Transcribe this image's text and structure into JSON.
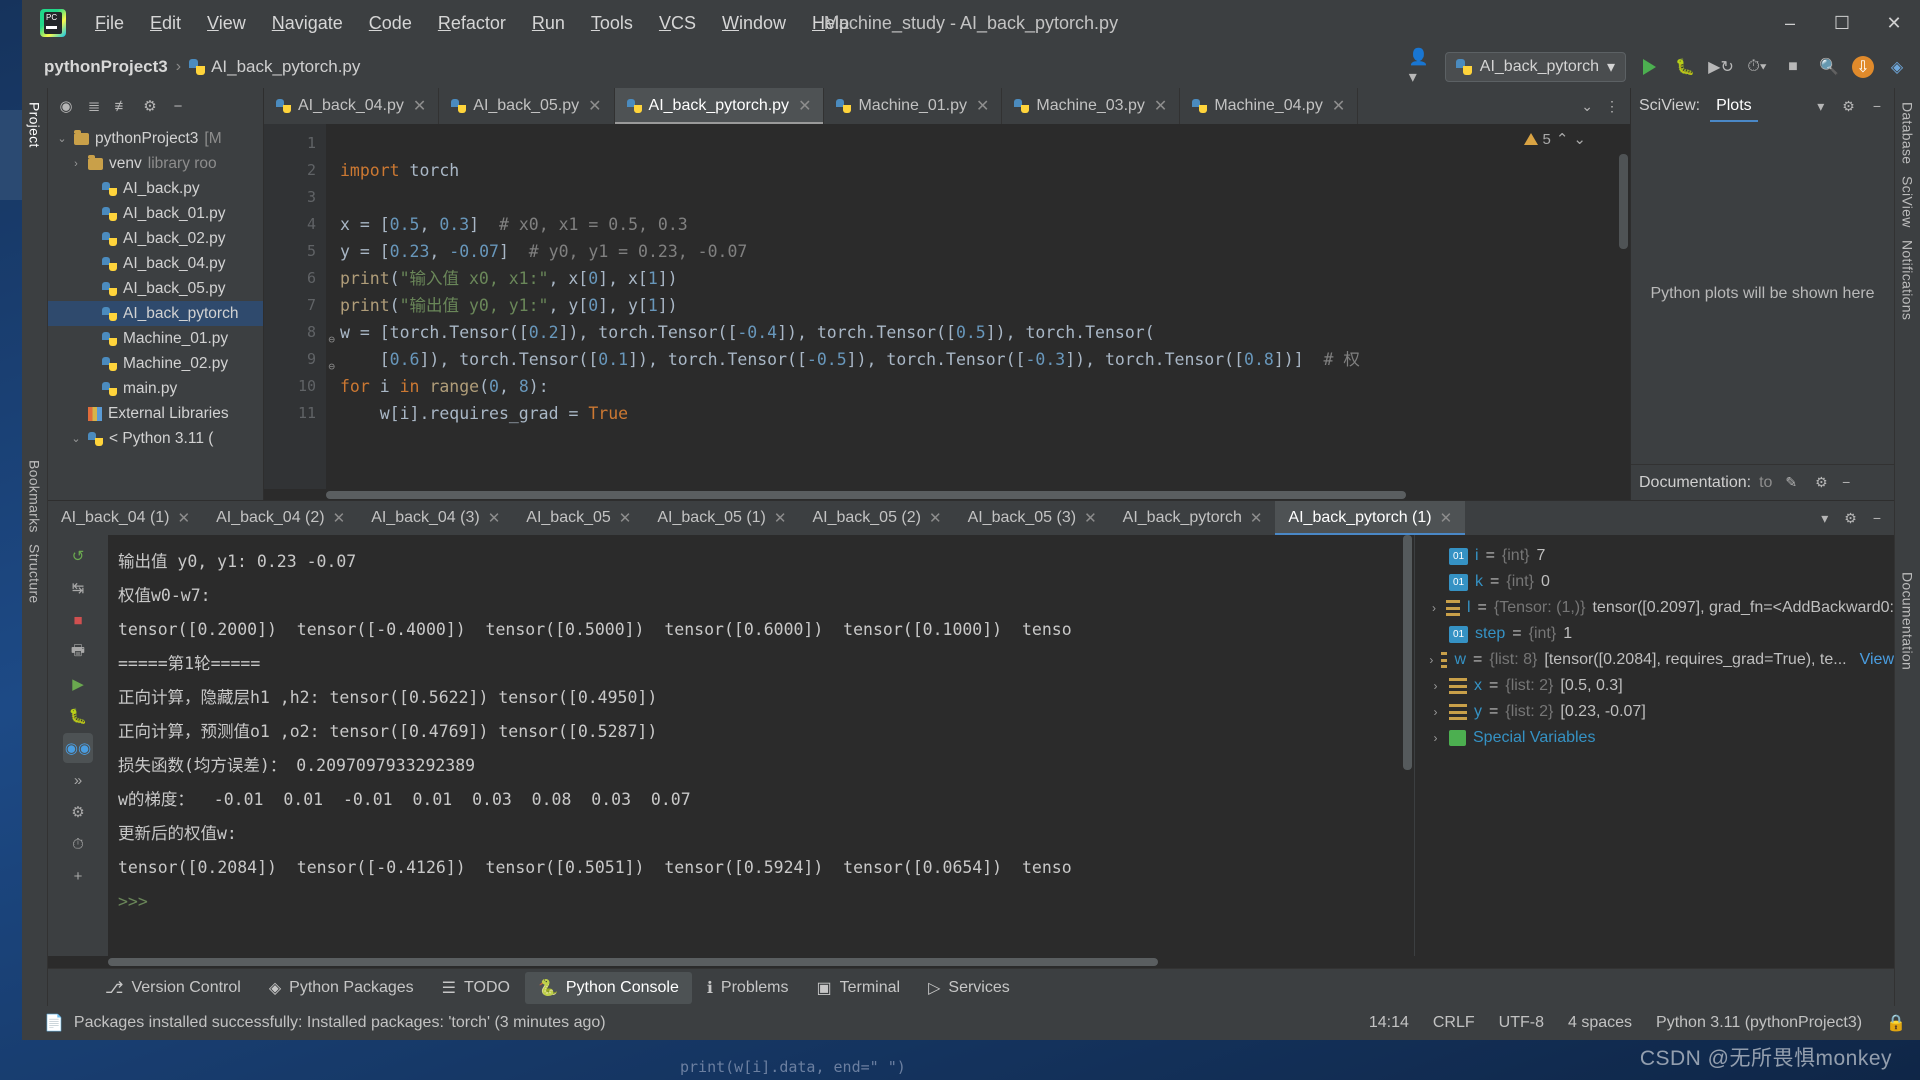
{
  "window": {
    "title": "Machine_study - AI_back_pytorch.py",
    "logo_text": "PC",
    "minimize": "–",
    "maximize": "☐",
    "close": "✕"
  },
  "menu": [
    {
      "label": "File"
    },
    {
      "label": "Edit"
    },
    {
      "label": "View"
    },
    {
      "label": "Navigate"
    },
    {
      "label": "Code"
    },
    {
      "label": "Refactor"
    },
    {
      "label": "Run"
    },
    {
      "label": "Tools"
    },
    {
      "label": "VCS"
    },
    {
      "label": "Window"
    },
    {
      "label": "Help"
    }
  ],
  "toolbar": {
    "breadcrumb_project": "pythonProject3",
    "breadcrumb_sep": "›",
    "breadcrumb_file": "AI_back_pytorch.py",
    "run_config": "AI_back_pytorch",
    "run_config_caret": "▾",
    "icons": {
      "user": "user-icon",
      "run": "run-icon",
      "debug": "debug-icon",
      "run_coverage": "run-coverage-icon",
      "profile": "profile-icon",
      "stop": "stop-icon",
      "search": "search-icon",
      "update": "update-icon",
      "ai": "ai-assistant-icon"
    }
  },
  "left_strip": [
    {
      "label": "Project",
      "selected": true
    },
    {
      "label": "Bookmarks",
      "selected": false
    },
    {
      "label": "Structure",
      "selected": false
    }
  ],
  "right_strip": [
    {
      "label": "Database"
    },
    {
      "label": "SciView"
    },
    {
      "label": "Notifications"
    },
    {
      "label": "Documentation"
    }
  ],
  "project": {
    "header_icons": [
      "project-widget-icon",
      "gear-icon",
      "collapse-icon",
      "expand-icon",
      "hide-icon"
    ],
    "tree": [
      {
        "indent": 0,
        "twisty": "⌄",
        "icon": "folder",
        "label": "pythonProject3",
        "suffix": "[M",
        "selected": false
      },
      {
        "indent": 1,
        "twisty": "›",
        "icon": "folder",
        "label": "venv",
        "suffix": "library roo",
        "selected": false
      },
      {
        "indent": 2,
        "twisty": "",
        "icon": "py",
        "label": "AI_back.py",
        "suffix": "",
        "selected": false
      },
      {
        "indent": 2,
        "twisty": "",
        "icon": "py",
        "label": "AI_back_01.py",
        "suffix": "",
        "selected": false
      },
      {
        "indent": 2,
        "twisty": "",
        "icon": "py",
        "label": "AI_back_02.py",
        "suffix": "",
        "selected": false
      },
      {
        "indent": 2,
        "twisty": "",
        "icon": "py",
        "label": "AI_back_04.py",
        "suffix": "",
        "selected": false
      },
      {
        "indent": 2,
        "twisty": "",
        "icon": "py",
        "label": "AI_back_05.py",
        "suffix": "",
        "selected": false
      },
      {
        "indent": 2,
        "twisty": "",
        "icon": "py",
        "label": "AI_back_pytorch",
        "suffix": "",
        "selected": true
      },
      {
        "indent": 2,
        "twisty": "",
        "icon": "py",
        "label": "Machine_01.py",
        "suffix": "",
        "selected": false
      },
      {
        "indent": 2,
        "twisty": "",
        "icon": "py",
        "label": "Machine_02.py",
        "suffix": "",
        "selected": false
      },
      {
        "indent": 2,
        "twisty": "",
        "icon": "py",
        "label": "main.py",
        "suffix": "",
        "selected": false
      },
      {
        "indent": 1,
        "twisty": "",
        "icon": "lib",
        "label": "External Libraries",
        "suffix": "",
        "selected": false
      },
      {
        "indent": 1,
        "twisty": "⌄",
        "icon": "py",
        "label": "< Python 3.11 (",
        "suffix": "",
        "selected": false
      }
    ]
  },
  "editor": {
    "tabs": [
      {
        "label": "AI_back_04.py",
        "active": false
      },
      {
        "label": "AI_back_05.py",
        "active": false
      },
      {
        "label": "AI_back_pytorch.py",
        "active": true
      },
      {
        "label": "Machine_01.py",
        "active": false
      },
      {
        "label": "Machine_03.py",
        "active": false
      },
      {
        "label": "Machine_04.py",
        "active": false
      }
    ],
    "tab_close_glyph": "✕",
    "tabs_overflow": "⌄",
    "tabs_more": "⋮",
    "warning_count": "5",
    "warn_up": "⌃",
    "warn_down": "⌄",
    "lines": [
      {
        "num": "1",
        "tokens": []
      },
      {
        "num": "2",
        "tokens": [
          {
            "t": "import",
            "c": "k"
          },
          {
            "t": " torch",
            "c": "id"
          }
        ]
      },
      {
        "num": "3",
        "tokens": []
      },
      {
        "num": "4",
        "tokens": [
          {
            "t": "x = [",
            "c": "id"
          },
          {
            "t": "0.5",
            "c": "n"
          },
          {
            "t": ", ",
            "c": "id"
          },
          {
            "t": "0.3",
            "c": "n"
          },
          {
            "t": "]  ",
            "c": "id"
          },
          {
            "t": "# x0, x1 = 0.5, 0.3",
            "c": "c"
          }
        ]
      },
      {
        "num": "5",
        "tokens": [
          {
            "t": "y = [",
            "c": "id"
          },
          {
            "t": "0.23",
            "c": "n"
          },
          {
            "t": ", ",
            "c": "id"
          },
          {
            "t": "-0.07",
            "c": "n"
          },
          {
            "t": "]  ",
            "c": "id"
          },
          {
            "t": "# y0, y1 = 0.23, -0.07",
            "c": "c"
          }
        ]
      },
      {
        "num": "6",
        "tokens": [
          {
            "t": "print",
            "c": "f"
          },
          {
            "t": "(",
            "c": "id"
          },
          {
            "t": "\"输入值 x0, x1:\"",
            "c": "s"
          },
          {
            "t": ", x[",
            "c": "id"
          },
          {
            "t": "0",
            "c": "n"
          },
          {
            "t": "], x[",
            "c": "id"
          },
          {
            "t": "1",
            "c": "n"
          },
          {
            "t": "])",
            "c": "id"
          }
        ]
      },
      {
        "num": "7",
        "tokens": [
          {
            "t": "print",
            "c": "f"
          },
          {
            "t": "(",
            "c": "id"
          },
          {
            "t": "\"输出值 y0, y1:\"",
            "c": "s"
          },
          {
            "t": ", y[",
            "c": "id"
          },
          {
            "t": "0",
            "c": "n"
          },
          {
            "t": "], y[",
            "c": "id"
          },
          {
            "t": "1",
            "c": "n"
          },
          {
            "t": "])",
            "c": "id"
          }
        ]
      },
      {
        "num": "8",
        "tokens": [
          {
            "t": "w = [torch.Tensor([",
            "c": "id"
          },
          {
            "t": "0.2",
            "c": "n"
          },
          {
            "t": "]), torch.Tensor([",
            "c": "id"
          },
          {
            "t": "-0.4",
            "c": "n"
          },
          {
            "t": "]), torch.Tensor([",
            "c": "id"
          },
          {
            "t": "0.5",
            "c": "n"
          },
          {
            "t": "]), torch.Tensor(",
            "c": "id"
          }
        ]
      },
      {
        "num": "9",
        "tokens": [
          {
            "t": "    [",
            "c": "id"
          },
          {
            "t": "0.6",
            "c": "n"
          },
          {
            "t": "]), torch.Tensor([",
            "c": "id"
          },
          {
            "t": "0.1",
            "c": "n"
          },
          {
            "t": "]), torch.Tensor([",
            "c": "id"
          },
          {
            "t": "-0.5",
            "c": "n"
          },
          {
            "t": "]), torch.Tensor([",
            "c": "id"
          },
          {
            "t": "-0.3",
            "c": "n"
          },
          {
            "t": "]), torch.Tensor([",
            "c": "id"
          },
          {
            "t": "0.8",
            "c": "n"
          },
          {
            "t": "])]  ",
            "c": "id"
          },
          {
            "t": "# 权",
            "c": "c"
          }
        ]
      },
      {
        "num": "10",
        "tokens": [
          {
            "t": "for",
            "c": "k"
          },
          {
            "t": " i ",
            "c": "id"
          },
          {
            "t": "in",
            "c": "k"
          },
          {
            "t": " ",
            "c": "id"
          },
          {
            "t": "range",
            "c": "f"
          },
          {
            "t": "(",
            "c": "id"
          },
          {
            "t": "0",
            "c": "n"
          },
          {
            "t": ", ",
            "c": "id"
          },
          {
            "t": "8",
            "c": "n"
          },
          {
            "t": "):",
            "c": "id"
          }
        ]
      },
      {
        "num": "11",
        "tokens": [
          {
            "t": "    w[i].requires_grad = ",
            "c": "id"
          },
          {
            "t": "True",
            "c": "k"
          }
        ]
      }
    ]
  },
  "sciview": {
    "label": "SciView:",
    "tab": "Plots",
    "empty_message": "Python plots will be shown here",
    "doc_label": "Documentation:",
    "doc_value": "to",
    "icons": [
      "chevron-down-icon",
      "gear-icon",
      "hide-icon",
      "edit-icon"
    ]
  },
  "console": {
    "tabs": [
      {
        "label": "AI_back_04 (1)",
        "active": false
      },
      {
        "label": "AI_back_04 (2)",
        "active": false
      },
      {
        "label": "AI_back_04 (3)",
        "active": false
      },
      {
        "label": "AI_back_05",
        "active": false
      },
      {
        "label": "AI_back_05 (1)",
        "active": false
      },
      {
        "label": "AI_back_05 (2)",
        "active": false
      },
      {
        "label": "AI_back_05 (3)",
        "active": false
      },
      {
        "label": "AI_back_pytorch",
        "active": false
      },
      {
        "label": "AI_back_pytorch (1)",
        "active": true
      }
    ],
    "tab_close_glyph": "✕",
    "gutter_icons": [
      "rerun-icon",
      "soft-wrap-icon",
      "stop-icon",
      "print-icon",
      "execute-icon",
      "attach-debugger-icon",
      "show-variables-icon",
      "scroll-to-end-icon",
      "settings-icon",
      "history-icon",
      "add-icon"
    ],
    "output": [
      "输出值 y0, y1: 0.23 -0.07",
      "权值w0-w7:",
      "tensor([0.2000])  tensor([-0.4000])  tensor([0.5000])  tensor([0.6000])  tensor([0.1000])  tenso",
      "=====第1轮=====",
      "正向计算，隐藏层h1 ,h2: tensor([0.5622]) tensor([0.4950])",
      "正向计算，预测值o1 ,o2: tensor([0.4769]) tensor([0.5287])",
      "损失函数(均方误差)： 0.2097097933292389",
      "w的梯度：  -0.01  0.01  -0.01  0.01  0.03  0.08  0.03  0.07",
      "更新后的权值w:",
      "tensor([0.2084])  tensor([-0.4126])  tensor([0.5051])  tensor([0.5924])  tensor([0.0654])  tenso"
    ],
    "prompt": ">>>"
  },
  "variables": [
    {
      "arrow": "",
      "icon": "int",
      "name": "i",
      "type": "{int}",
      "value": "7",
      "link": ""
    },
    {
      "arrow": "",
      "icon": "int",
      "name": "k",
      "type": "{int}",
      "value": "0",
      "link": ""
    },
    {
      "arrow": "›",
      "icon": "list",
      "name": "l",
      "type": "{Tensor: (1,)}",
      "value": "tensor([0.2097], grad_fn=<AddBackward0:",
      "link": ""
    },
    {
      "arrow": "",
      "icon": "int",
      "name": "step",
      "type": "{int}",
      "value": "1",
      "link": ""
    },
    {
      "arrow": "›",
      "icon": "list",
      "name": "w",
      "type": "{list: 8}",
      "value": "[tensor([0.2084], requires_grad=True), te...",
      "link": "View"
    },
    {
      "arrow": "›",
      "icon": "list",
      "name": "x",
      "type": "{list: 2}",
      "value": "[0.5, 0.3]",
      "link": ""
    },
    {
      "arrow": "›",
      "icon": "list",
      "name": "y",
      "type": "{list: 2}",
      "value": "[0.23, -0.07]",
      "link": ""
    },
    {
      "arrow": "›",
      "icon": "star",
      "name": "Special Variables",
      "type": "",
      "value": "",
      "link": ""
    }
  ],
  "bottom_bar": [
    {
      "label": "Version Control",
      "icon": "branch-icon",
      "active": false
    },
    {
      "label": "Python Packages",
      "icon": "packages-icon",
      "active": false
    },
    {
      "label": "TODO",
      "icon": "todo-icon",
      "active": false
    },
    {
      "label": "Python Console",
      "icon": "python-console-icon",
      "active": true
    },
    {
      "label": "Problems",
      "icon": "problems-icon",
      "active": false
    },
    {
      "label": "Terminal",
      "icon": "terminal-icon",
      "active": false
    },
    {
      "label": "Services",
      "icon": "services-icon",
      "active": false
    }
  ],
  "status_bar": {
    "message": "Packages installed successfully: Installed packages: 'torch' (3 minutes ago)",
    "message_icon": "event-log-icon",
    "position": "14:14",
    "line_sep": "CRLF",
    "encoding": "UTF-8",
    "indent": "4 spaces",
    "interpreter": "Python 3.11 (pythonProject3)",
    "lock_icon": "lock-icon"
  },
  "watermark": "CSDN @无所畏惧monkey",
  "bg_peek": "print(w[i].data, end=\"  \")",
  "colors": {
    "accent_blue": "#4a88c7",
    "selection": "#2f4a6d",
    "editor_bg": "#2b2b2b",
    "chrome_bg": "#3c3f41",
    "string_green": "#6a8759",
    "keyword_orange": "#cc7832",
    "number_blue": "#6897bb"
  }
}
